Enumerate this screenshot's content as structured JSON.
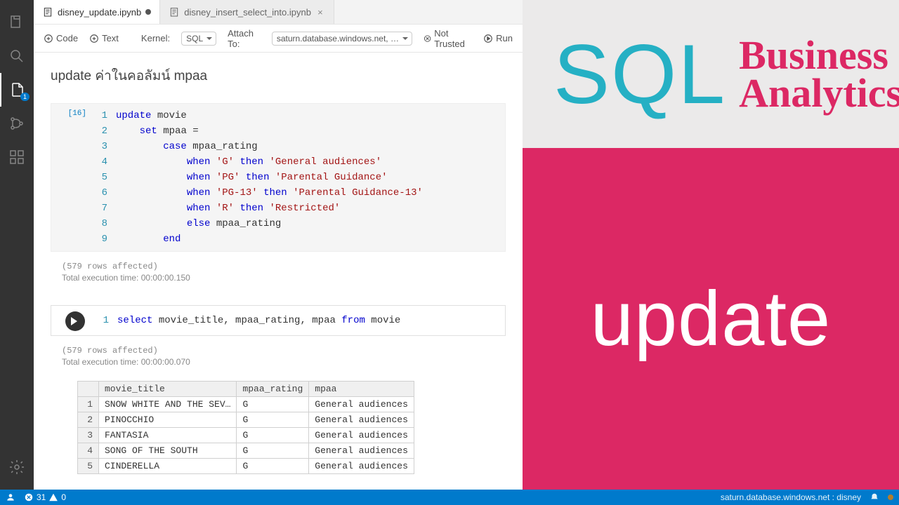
{
  "tabs": [
    {
      "label": "disney_update.ipynb",
      "dirty": true,
      "active": true
    },
    {
      "label": "disney_insert_select_into.ipynb",
      "dirty": false,
      "active": false
    }
  ],
  "toolbar": {
    "code": "Code",
    "text": "Text",
    "kernel_label": "Kernel:",
    "kernel_value": "SQL",
    "attach_label": "Attach To:",
    "attach_value": "saturn.database.windows.net, …",
    "trusted": "Not Trusted",
    "run": "Run"
  },
  "heading": "update ค่าในคอลัมน์ mpaa",
  "cell1": {
    "exec": "[16]",
    "footer1": "(579 rows affected)",
    "footer2": "Total execution time: 00:00:00.150",
    "lines": [
      {
        "n": "1",
        "html": "<span class='kw'>update</span> <span class='id'>movie</span>"
      },
      {
        "n": "2",
        "html": "    <span class='kw'>set</span> <span class='id'>mpaa =</span>"
      },
      {
        "n": "3",
        "html": "        <span class='kw'>case</span> <span class='id'>mpaa_rating</span>"
      },
      {
        "n": "4",
        "html": "            <span class='kw'>when</span> <span class='str'>'G'</span> <span class='kw'>then</span> <span class='str'>'General audiences'</span>"
      },
      {
        "n": "5",
        "html": "            <span class='kw'>when</span> <span class='str'>'PG'</span> <span class='kw'>then</span> <span class='str'>'Parental Guidance'</span>"
      },
      {
        "n": "6",
        "html": "            <span class='kw'>when</span> <span class='str'>'PG-13'</span> <span class='kw'>then</span> <span class='str'>'Parental Guidance-13'</span>"
      },
      {
        "n": "7",
        "html": "            <span class='kw'>when</span> <span class='str'>'R'</span> <span class='kw'>then</span> <span class='str'>'Restricted'</span>"
      },
      {
        "n": "8",
        "html": "            <span class='kw'>else</span> <span class='id'>mpaa_rating</span>"
      },
      {
        "n": "9",
        "html": "        <span class='kw'>end</span>"
      }
    ]
  },
  "cell2": {
    "footer1": "(579 rows affected)",
    "footer2": "Total execution time: 00:00:00.070",
    "line": {
      "n": "1",
      "html": "<span class='kw'>select</span> <span class='id'>movie_title, mpaa_rating, mpaa</span> <span class='kw'>from</span> <span class='id'>movie</span>"
    }
  },
  "table": {
    "headers": [
      "movie_title",
      "mpaa_rating",
      "mpaa"
    ],
    "rows": [
      [
        "1",
        "SNOW WHITE AND THE SEV…",
        "G",
        "General audiences"
      ],
      [
        "2",
        "PINOCCHIO",
        "G",
        "General audiences"
      ],
      [
        "3",
        "FANTASIA",
        "G",
        "General audiences"
      ],
      [
        "4",
        "SONG OF THE SOUTH",
        "G",
        "General audiences"
      ],
      [
        "5",
        "CINDERELLA",
        "G",
        "General audiences"
      ]
    ]
  },
  "statusbar": {
    "errors": "31",
    "warnings": "0",
    "right": "saturn.database.windows.net : disney"
  },
  "activity": {
    "explorer_badge": "1"
  },
  "overlay": {
    "sql": "SQL",
    "b": "Business",
    "a": "Analytics",
    "u": "update"
  }
}
